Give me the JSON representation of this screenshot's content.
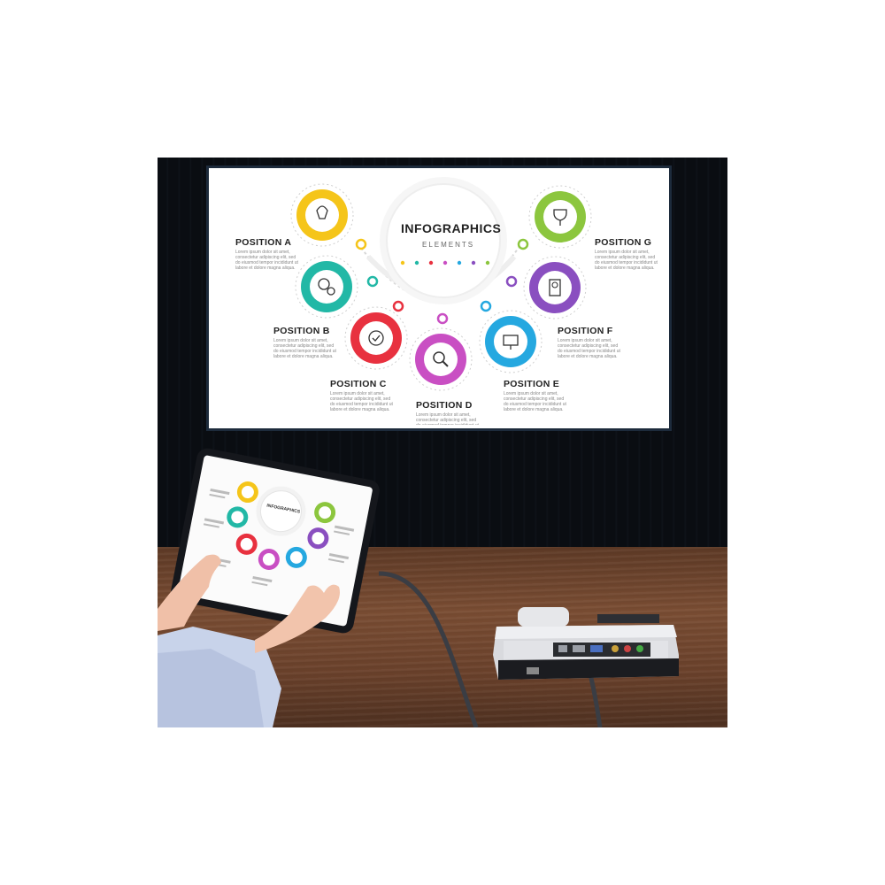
{
  "screen": {
    "title": "INFOGRAPHICS",
    "subtitle": "ELEMENTS",
    "positions": [
      {
        "label": "POSITION A",
        "color": "#f5c51a"
      },
      {
        "label": "POSITION B",
        "color": "#22b8a6"
      },
      {
        "label": "POSITION C",
        "color": "#e8313f"
      },
      {
        "label": "POSITION D",
        "color": "#c94fc3"
      },
      {
        "label": "POSITION E",
        "color": "#25a8e0"
      },
      {
        "label": "POSITION F",
        "color": "#8a4fc0"
      },
      {
        "label": "POSITION G",
        "color": "#8cc63e"
      }
    ],
    "lorem": "Lorem ipsum dolor sit amet, consectetur adipiscing elit, sed do eiusmod tempor incididunt ut labore et dolore magna aliqua."
  },
  "tablet": {
    "title": "INFOGRAPHICS"
  },
  "colors": {
    "wall": "#0a0d12",
    "table": "#6e4630",
    "bezel": "#1d2b3c"
  }
}
